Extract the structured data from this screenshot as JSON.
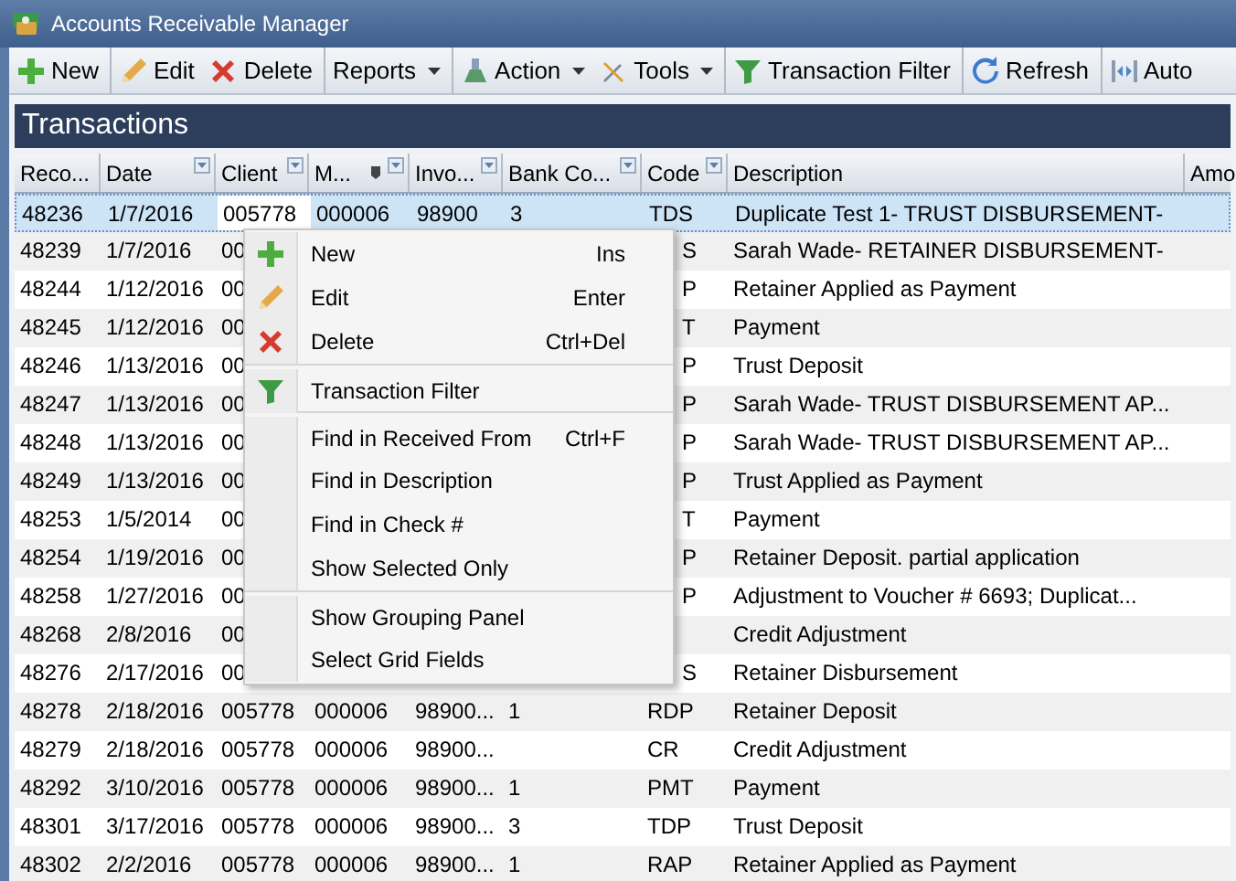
{
  "window": {
    "title": "Accounts Receivable Manager"
  },
  "toolbar": [
    {
      "label": "New",
      "kind": "new",
      "dropdown": false,
      "group_start": false
    },
    {
      "label": "Edit",
      "kind": "edit",
      "dropdown": false,
      "group_start": true
    },
    {
      "label": "Delete",
      "kind": "delete",
      "dropdown": false,
      "group_start": false
    },
    {
      "label": "Reports",
      "kind": "plain",
      "dropdown": true,
      "group_start": true
    },
    {
      "label": "Action",
      "kind": "action",
      "dropdown": true,
      "group_start": true
    },
    {
      "label": "Tools",
      "kind": "tools",
      "dropdown": true,
      "group_start": false
    },
    {
      "label": "Transaction Filter",
      "kind": "filter",
      "dropdown": false,
      "group_start": true
    },
    {
      "label": "Refresh",
      "kind": "refresh",
      "dropdown": false,
      "group_start": true
    },
    {
      "label": "Auto",
      "kind": "autofit",
      "dropdown": false,
      "group_start": true
    }
  ],
  "panel_title": "Transactions",
  "table": {
    "columns": [
      {
        "label": "Reco...",
        "filter": false,
        "pin": false
      },
      {
        "label": "Date",
        "filter": true,
        "pin": false
      },
      {
        "label": "Client",
        "filter": true,
        "pin": false
      },
      {
        "label": "M...",
        "filter": true,
        "pin": true
      },
      {
        "label": "Invo...",
        "filter": true,
        "pin": false
      },
      {
        "label": "Bank Co...",
        "filter": true,
        "pin": false
      },
      {
        "label": "Code",
        "filter": true,
        "pin": false
      },
      {
        "label": "Description",
        "filter": false,
        "pin": false
      },
      {
        "label": "Amo"
      }
    ],
    "rows": [
      {
        "selected": true,
        "covered": false,
        "cells": [
          "48236",
          "1/7/2016",
          "005778",
          "000006",
          "98900",
          "3",
          "TDS",
          "Duplicate Test 1- TRUST DISBURSEMENT-"
        ]
      },
      {
        "selected": false,
        "covered": true,
        "cells": [
          "48239",
          "1/7/2016",
          "00",
          "",
          "",
          "",
          "S",
          "Sarah Wade- RETAINER DISBURSEMENT-"
        ]
      },
      {
        "selected": false,
        "covered": true,
        "cells": [
          "48244",
          "1/12/2016",
          "00",
          "",
          "",
          "",
          "P",
          "Retainer Applied as Payment"
        ]
      },
      {
        "selected": false,
        "covered": true,
        "cells": [
          "48245",
          "1/12/2016",
          "00",
          "",
          "",
          "",
          "T",
          "Payment"
        ]
      },
      {
        "selected": false,
        "covered": true,
        "cells": [
          "48246",
          "1/13/2016",
          "00",
          "",
          "",
          "",
          "P",
          "Trust Deposit"
        ]
      },
      {
        "selected": false,
        "covered": true,
        "cells": [
          "48247",
          "1/13/2016",
          "00",
          "",
          "",
          "",
          "P",
          "Sarah Wade- TRUST DISBURSEMENT AP..."
        ]
      },
      {
        "selected": false,
        "covered": true,
        "cells": [
          "48248",
          "1/13/2016",
          "00",
          "",
          "",
          "",
          "P",
          "Sarah Wade- TRUST DISBURSEMENT AP..."
        ]
      },
      {
        "selected": false,
        "covered": true,
        "cells": [
          "48249",
          "1/13/2016",
          "00",
          "",
          "",
          "",
          "P",
          "Trust Applied as Payment"
        ]
      },
      {
        "selected": false,
        "covered": true,
        "cells": [
          "48253",
          "1/5/2014",
          "00",
          "",
          "",
          "",
          "T",
          "Payment"
        ]
      },
      {
        "selected": false,
        "covered": true,
        "cells": [
          "48254",
          "1/19/2016",
          "00",
          "",
          "",
          "",
          "P",
          "Retainer Deposit. partial application"
        ]
      },
      {
        "selected": false,
        "covered": true,
        "cells": [
          "48258",
          "1/27/2016",
          "00",
          "",
          "",
          "",
          "P",
          "Adjustment to Voucher # 6693; Duplicat..."
        ]
      },
      {
        "selected": false,
        "covered": true,
        "cells": [
          "48268",
          "2/8/2016",
          "00",
          "",
          "",
          "",
          "",
          "Credit Adjustment"
        ]
      },
      {
        "selected": false,
        "covered": true,
        "cells": [
          "48276",
          "2/17/2016",
          "00",
          "",
          "",
          "",
          "S",
          "Retainer Disbursement"
        ]
      },
      {
        "selected": false,
        "covered": false,
        "cells": [
          "48278",
          "2/18/2016",
          "005778",
          "000006",
          "98900...",
          "1",
          "RDP",
          "Retainer Deposit"
        ]
      },
      {
        "selected": false,
        "covered": false,
        "cells": [
          "48279",
          "2/18/2016",
          "005778",
          "000006",
          "98900...",
          "",
          "CR",
          "Credit Adjustment"
        ]
      },
      {
        "selected": false,
        "covered": false,
        "cells": [
          "48292",
          "3/10/2016",
          "005778",
          "000006",
          "98900...",
          "1",
          "PMT",
          "Payment"
        ]
      },
      {
        "selected": false,
        "covered": false,
        "cells": [
          "48301",
          "3/17/2016",
          "005778",
          "000006",
          "98900...",
          "3",
          "TDP",
          "Trust Deposit"
        ]
      },
      {
        "selected": false,
        "covered": false,
        "cells": [
          "48302",
          "2/2/2016",
          "005778",
          "000006",
          "98900...",
          "1",
          "RAP",
          "Retainer Applied as Payment"
        ]
      }
    ]
  },
  "context_menu": [
    {
      "label": "New",
      "shortcut": "Ins",
      "kind": "new",
      "separator_before": false
    },
    {
      "label": "Edit",
      "shortcut": "Enter",
      "kind": "edit",
      "separator_before": false
    },
    {
      "label": "Delete",
      "shortcut": "Ctrl+Del",
      "kind": "delete",
      "separator_before": false
    },
    {
      "label": "Transaction Filter",
      "kind": "filter",
      "separator_before": true
    },
    {
      "label": "Find in Received From",
      "shortcut": "Ctrl+F",
      "kind": "plain",
      "separator_before": true
    },
    {
      "label": "Find in Description",
      "kind": "plain",
      "separator_before": false
    },
    {
      "label": "Find in Check #",
      "kind": "plain",
      "separator_before": false
    },
    {
      "label": "Show Selected Only",
      "kind": "plain",
      "separator_before": false
    },
    {
      "label": "Show Grouping Panel",
      "kind": "plain",
      "separator_before": true
    },
    {
      "label": "Select Grid Fields",
      "kind": "plain",
      "separator_before": false
    }
  ]
}
